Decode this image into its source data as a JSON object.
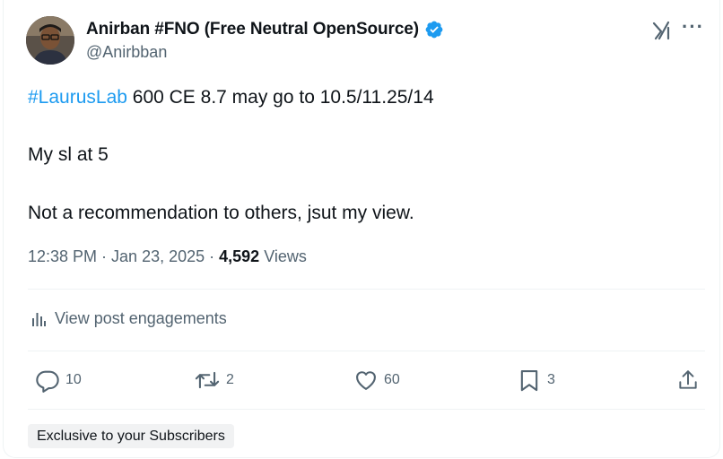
{
  "author": {
    "name": "Anirban #FNO (Free Neutral OpenSource)",
    "handle": "@Anirbban",
    "verified_icon": "verified-badge-icon"
  },
  "post": {
    "hashtag": "#LaurusLab",
    "line1_rest": " 600 CE 8.7 may go to 10.5/11.25/14",
    "line2": "My sl at 5",
    "line3": "Not a recommendation to others, jsut my view."
  },
  "meta": {
    "timestamp": "12:38 PM · Jan 23, 2025 · ",
    "views_count": "4,592",
    "views_label": " Views"
  },
  "engagements_label": "View post engagements",
  "actions": {
    "replies": "10",
    "reposts": "2",
    "likes": "60",
    "bookmarks": "3"
  },
  "badge": "Exclusive to your Subscribers",
  "colors": {
    "accent": "#1d9bf0",
    "muted": "#536471",
    "text": "#0f1419"
  }
}
